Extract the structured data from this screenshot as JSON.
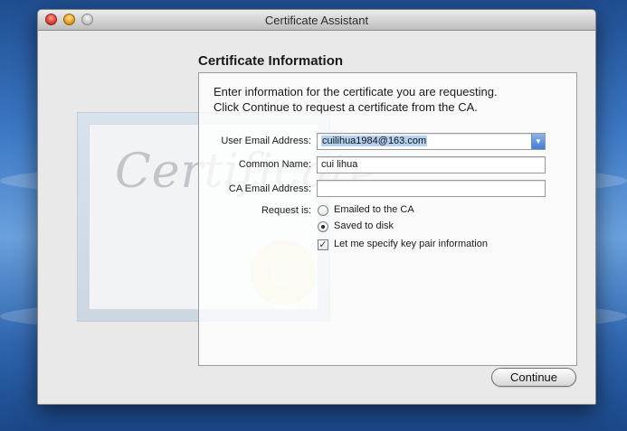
{
  "window": {
    "title": "Certificate Assistant"
  },
  "panel": {
    "heading": "Certificate Information",
    "intro_line1": "Enter information for the certificate you are requesting.",
    "intro_line2": "Click Continue to request a certificate from the CA."
  },
  "form": {
    "user_email_label": "User Email Address:",
    "user_email_value": "cuilihua1984@163.com",
    "common_name_label": "Common Name:",
    "common_name_value": "cui lihua",
    "ca_email_label": "CA Email Address:",
    "ca_email_value": "",
    "request_label": "Request is:",
    "request_options": [
      {
        "label": "Emailed to the CA",
        "selected": false
      },
      {
        "label": "Saved to disk",
        "selected": true
      }
    ],
    "key_pair_label": "Let me specify key pair information",
    "key_pair_checked": true
  },
  "buttons": {
    "continue_label": "Continue"
  },
  "background_art": {
    "watermark_text": "Certificate"
  },
  "colors": {
    "selection": "#b5d1f0",
    "accent": "#3f7bd6"
  }
}
